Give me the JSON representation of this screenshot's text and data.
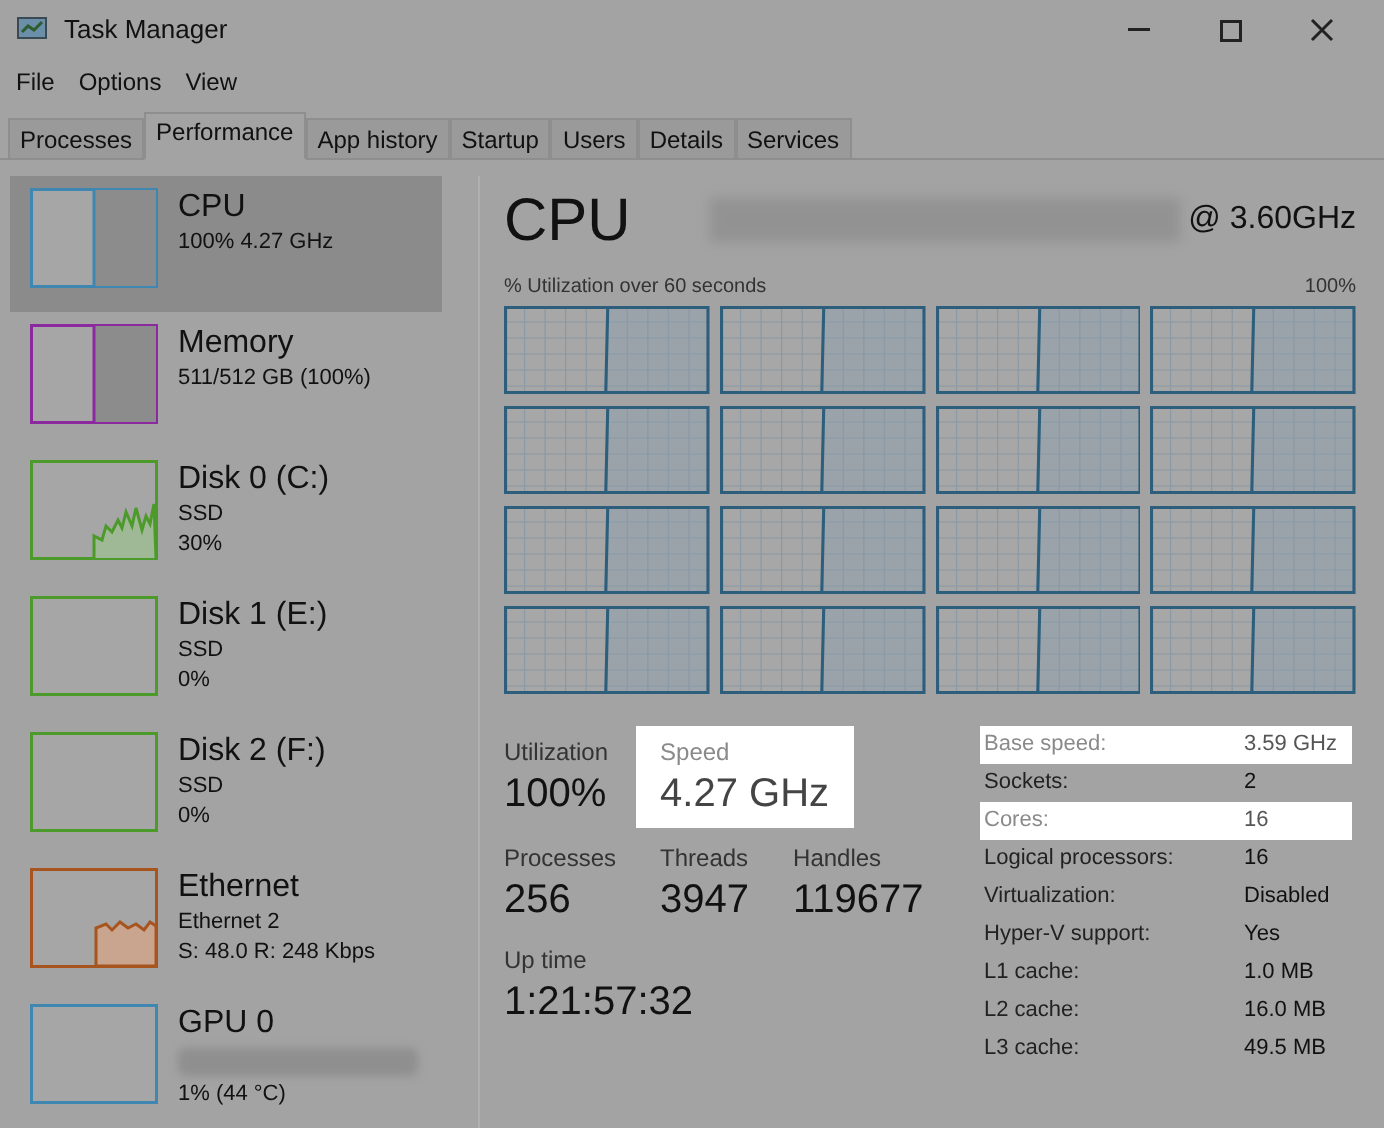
{
  "window": {
    "title": "Task Manager"
  },
  "menu": [
    "File",
    "Options",
    "View"
  ],
  "tabs": [
    {
      "label": "Processes",
      "selected": false
    },
    {
      "label": "Performance",
      "selected": true
    },
    {
      "label": "App history",
      "selected": false
    },
    {
      "label": "Startup",
      "selected": false
    },
    {
      "label": "Users",
      "selected": false
    },
    {
      "label": "Details",
      "selected": false
    },
    {
      "label": "Services",
      "selected": false
    }
  ],
  "sidebar": {
    "items": [
      {
        "name": "CPU",
        "lines": [
          "100% 4.27 GHz"
        ],
        "selected": true,
        "kind": "split",
        "color": "#3f86b0",
        "redacted_line": false
      },
      {
        "name": "Memory",
        "lines": [
          "511/512 GB (100%)"
        ],
        "selected": false,
        "kind": "split",
        "color": "#8b2a9e",
        "redacted_line": false
      },
      {
        "name": "Disk 0 (C:)",
        "lines": [
          "SSD",
          "30%"
        ],
        "selected": false,
        "kind": "line",
        "color": "#4c9a2a",
        "redacted_line": false
      },
      {
        "name": "Disk 1 (E:)",
        "lines": [
          "SSD",
          "0%"
        ],
        "selected": false,
        "kind": "empty",
        "color": "#4c9a2a",
        "redacted_line": false
      },
      {
        "name": "Disk 2 (F:)",
        "lines": [
          "SSD",
          "0%"
        ],
        "selected": false,
        "kind": "empty",
        "color": "#4c9a2a",
        "redacted_line": false
      },
      {
        "name": "Ethernet",
        "lines": [
          "Ethernet 2",
          "S: 48.0 R: 248 Kbps"
        ],
        "selected": false,
        "kind": "area",
        "color": "#a7541f",
        "redacted_line": false
      },
      {
        "name": "GPU 0",
        "lines": [
          "1% (44 °C)"
        ],
        "selected": false,
        "kind": "empty",
        "color": "#3f86b0",
        "redacted_line": true
      }
    ]
  },
  "main": {
    "title": "CPU",
    "model_redacted": true,
    "model_suffix": "@ 3.60GHz",
    "graph_label": "% Utilization over 60 seconds",
    "graph_max": "100%",
    "stats": [
      {
        "label": "Utilization",
        "value": "100%",
        "highlighted": false
      },
      {
        "label": "Speed",
        "value": "4.27 GHz",
        "highlighted": true
      },
      {
        "label": "Processes",
        "value": "256",
        "highlighted": false
      },
      {
        "label": "Threads",
        "value": "3947",
        "highlighted": false
      },
      {
        "label": "Handles",
        "value": "119677",
        "highlighted": false
      },
      {
        "label": "Up time",
        "value": "1:21:57:32",
        "highlighted": false
      }
    ],
    "details": [
      {
        "label": "Base speed:",
        "value": "3.59 GHz",
        "highlighted": true
      },
      {
        "label": "Sockets:",
        "value": "2",
        "highlighted": false
      },
      {
        "label": "Cores:",
        "value": "16",
        "highlighted": true
      },
      {
        "label": "Logical processors:",
        "value": "16",
        "highlighted": false
      },
      {
        "label": "Virtualization:",
        "value": "Disabled",
        "highlighted": false
      },
      {
        "label": "Hyper-V support:",
        "value": "Yes",
        "highlighted": false
      },
      {
        "label": "L1 cache:",
        "value": "1.0 MB",
        "highlighted": false
      },
      {
        "label": "L2 cache:",
        "value": "16.0 MB",
        "highlighted": false
      },
      {
        "label": "L3 cache:",
        "value": "49.5 MB",
        "highlighted": false
      }
    ]
  }
}
